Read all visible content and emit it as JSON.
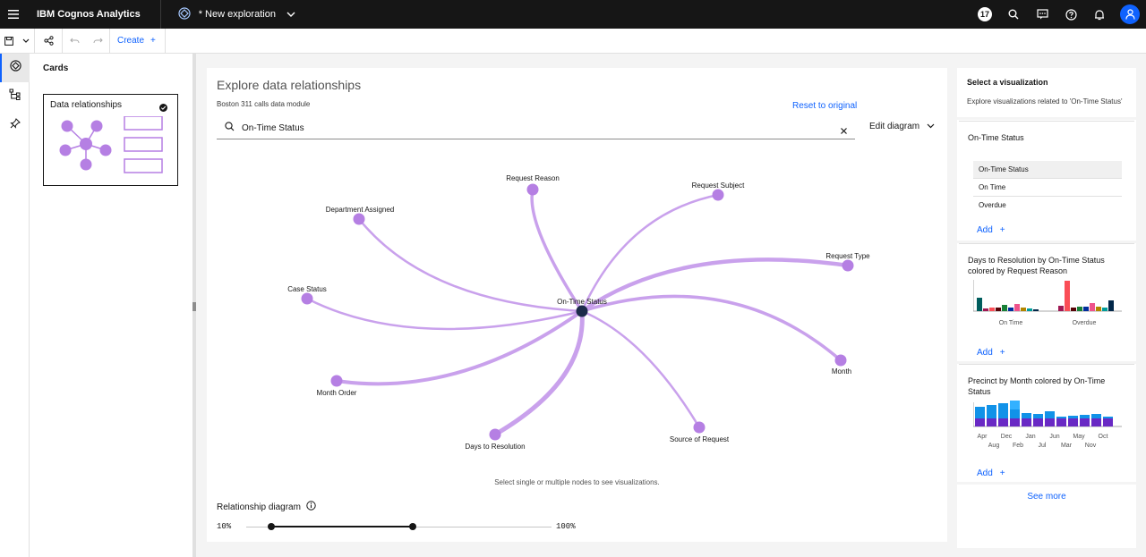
{
  "header": {
    "brand": "IBM Cognos Analytics",
    "exploration_title": "* New exploration",
    "notification_count": "17"
  },
  "toolbar": {
    "create_label": "Create",
    "create_plus": "+"
  },
  "cards_panel": {
    "title": "Cards",
    "card_label": "Data relationships"
  },
  "main": {
    "title": "Explore data relationships",
    "subtitle": "Boston 311 calls data module",
    "reset_label": "Reset to original",
    "search_value": "On-Time Status",
    "edit_diagram_label": "Edit diagram",
    "hint": "Select single or multiple nodes to see visualizations.",
    "relationship_label": "Relationship diagram",
    "slider_min": "10%",
    "slider_max": "100%",
    "slider_low_fraction": 0.1,
    "slider_high_fraction": 0.55
  },
  "diagram": {
    "center_label": "On-Time Status",
    "node_color": "#b57fe3",
    "center_color": "#1c2b4a",
    "edge_color": "#c9a1ec",
    "nodes": [
      {
        "label": "Request Reason"
      },
      {
        "label": "Request Subject"
      },
      {
        "label": "Department Assigned"
      },
      {
        "label": "Request Type"
      },
      {
        "label": "Case Status"
      },
      {
        "label": "Month"
      },
      {
        "label": "Month Order"
      },
      {
        "label": "Source of Request"
      },
      {
        "label": "Days to Resolution"
      }
    ]
  },
  "right_panel": {
    "title": "Select a visualization",
    "subtitle": "Explore visualizations related to 'On-Time Status'",
    "cards": [
      {
        "title": "On-Time Status",
        "table": [
          "On-Time Status",
          "On Time",
          "Overdue"
        ],
        "add_label": "Add"
      },
      {
        "title": "Days to Resolution by On-Time Status colored by Request Reason",
        "x_labels": [
          "On Time",
          "Overdue"
        ],
        "add_label": "Add"
      },
      {
        "title": "Precinct by Month colored by On-Time Status",
        "x_labels_row1": [
          "Apr",
          "Dec",
          "Jan",
          "Jun",
          "May",
          "Oct"
        ],
        "x_labels_row2": [
          "Aug",
          "Feb",
          "Jul",
          "Mar",
          "Nov"
        ],
        "add_label": "Add"
      }
    ],
    "see_more": "See more",
    "add_plus": "+"
  }
}
